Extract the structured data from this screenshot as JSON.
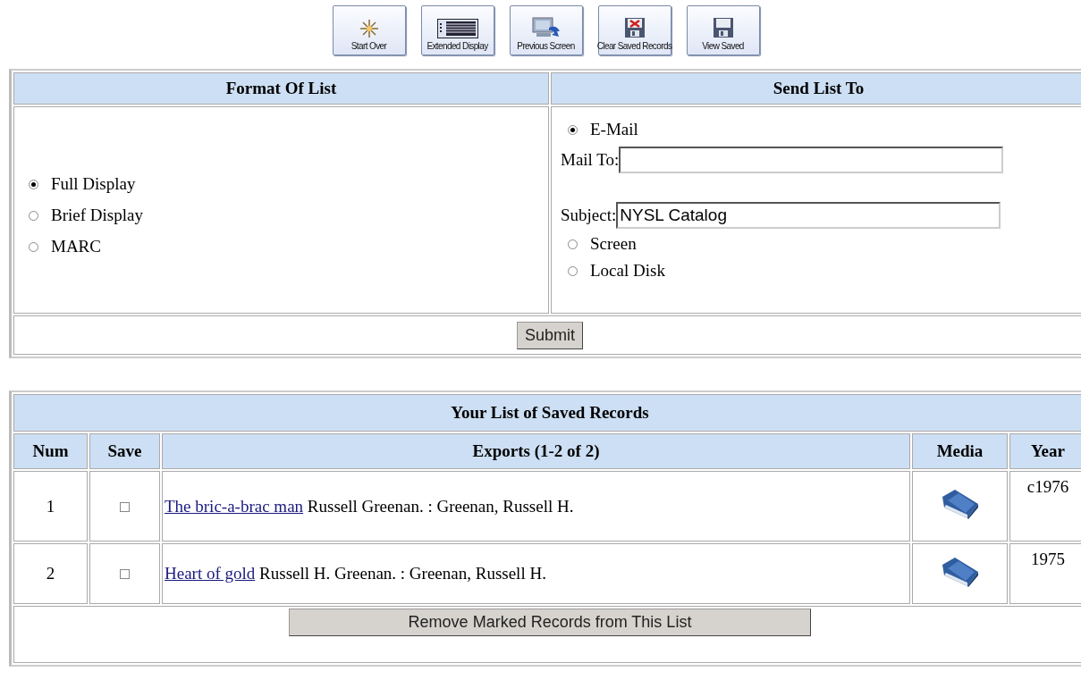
{
  "toolbar": [
    {
      "label": "Start Over",
      "kind": "star"
    },
    {
      "label": "Extended Display",
      "kind": "list"
    },
    {
      "label": "Previous Screen",
      "kind": "monitor"
    },
    {
      "label": "Clear Saved Records",
      "kind": "disk-x"
    },
    {
      "label": "View Saved",
      "kind": "disk"
    }
  ],
  "format_of_list": {
    "title": "Format Of List",
    "options": [
      {
        "label": "Full Display",
        "selected": true
      },
      {
        "label": "Brief Display",
        "selected": false
      },
      {
        "label": "MARC",
        "selected": false
      }
    ]
  },
  "send_list_to": {
    "title": "Send List To",
    "items": [
      {
        "kind": "radio",
        "label": "E-Mail",
        "selected": true
      },
      {
        "kind": "field",
        "label": "Mail To:"
      },
      {
        "kind": "field",
        "label": "Subject:",
        "value": "NYSL Catalog"
      },
      {
        "kind": "radio",
        "label": "Screen",
        "selected": false
      },
      {
        "kind": "radio",
        "label": "Local Disk",
        "selected": false
      }
    ]
  },
  "submit_button": "Submit",
  "saved_records": {
    "title": "Your List of Saved Records",
    "columns": [
      "Num",
      "Save",
      "Exports (1-2 of 2)",
      "Media",
      "Year"
    ],
    "rows": [
      {
        "num": "1",
        "checked": false,
        "title": "The bric-a-brac man",
        "details": "Russell Greenan. : Greenan, Russell H.",
        "year": "c1976"
      },
      {
        "num": "2",
        "checked": false,
        "title": "Heart of gold",
        "details": "Russell H. Greenan. : Greenan, Russell H.",
        "year": "1975"
      }
    ],
    "remove_button": "Remove Marked Records from This List"
  }
}
